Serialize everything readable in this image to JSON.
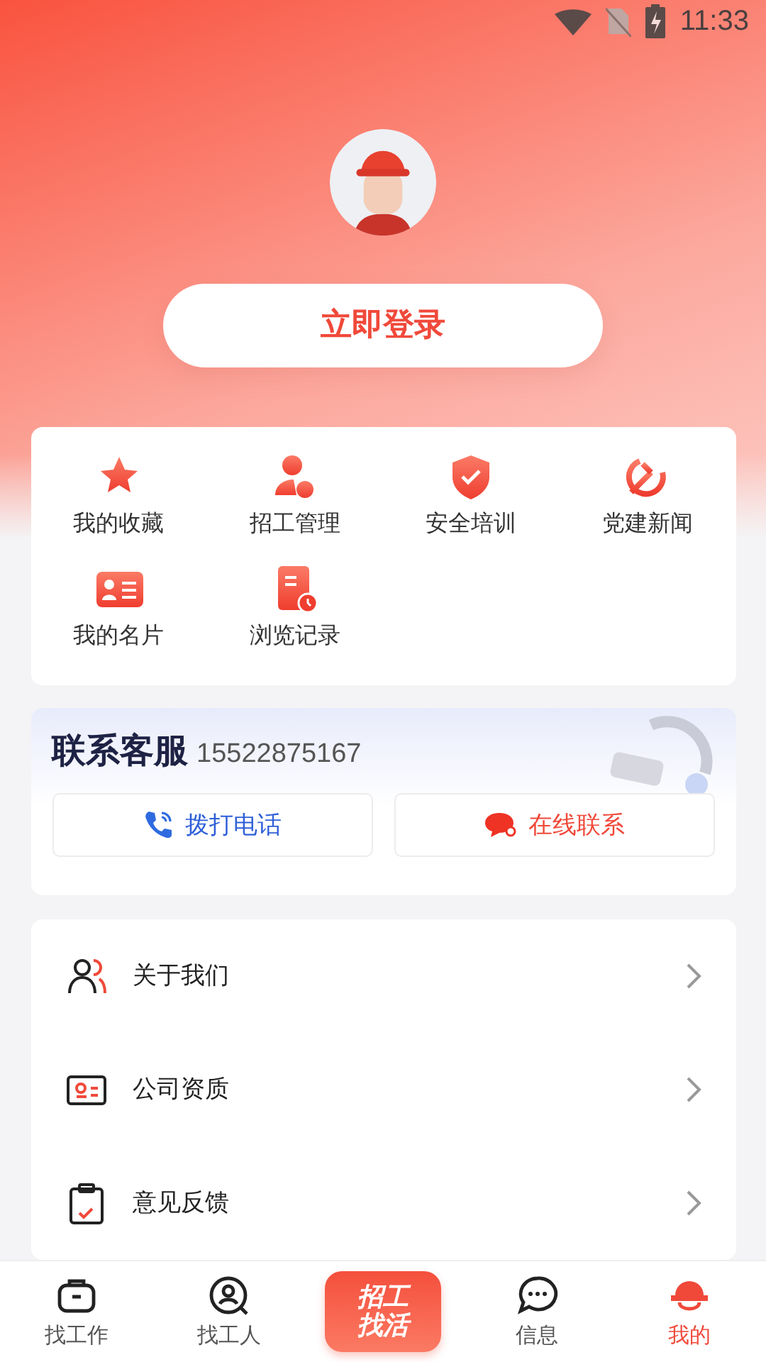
{
  "status_bar": {
    "time": "11:33"
  },
  "login_button": {
    "label": "立即登录"
  },
  "shortcuts": [
    {
      "label": "我的收藏",
      "kind": "star"
    },
    {
      "label": "招工管理",
      "kind": "person-gear"
    },
    {
      "label": "安全培训",
      "kind": "shield"
    },
    {
      "label": "党建新闻",
      "kind": "hammer-sickle"
    },
    {
      "label": "我的名片",
      "kind": "card"
    },
    {
      "label": "浏览记录",
      "kind": "history"
    }
  ],
  "service": {
    "title": "联系客服",
    "phone": "15522875167",
    "buttons": [
      {
        "label": "拨打电话",
        "kind": "call"
      },
      {
        "label": "在线联系",
        "kind": "chat"
      }
    ]
  },
  "menu": [
    {
      "label": "关于我们",
      "kind": "people"
    },
    {
      "label": "公司资质",
      "kind": "license"
    },
    {
      "label": "意见反馈",
      "kind": "clipboard"
    }
  ],
  "tab_bar": [
    {
      "label": "找工作",
      "kind": "briefcase",
      "selected": false
    },
    {
      "label": "找工人",
      "kind": "person-search",
      "selected": false
    },
    {
      "label": "招工找活",
      "kind": "center"
    },
    {
      "label": "信息",
      "kind": "chat",
      "selected": false
    },
    {
      "label": "我的",
      "kind": "helmet",
      "selected": true
    }
  ]
}
